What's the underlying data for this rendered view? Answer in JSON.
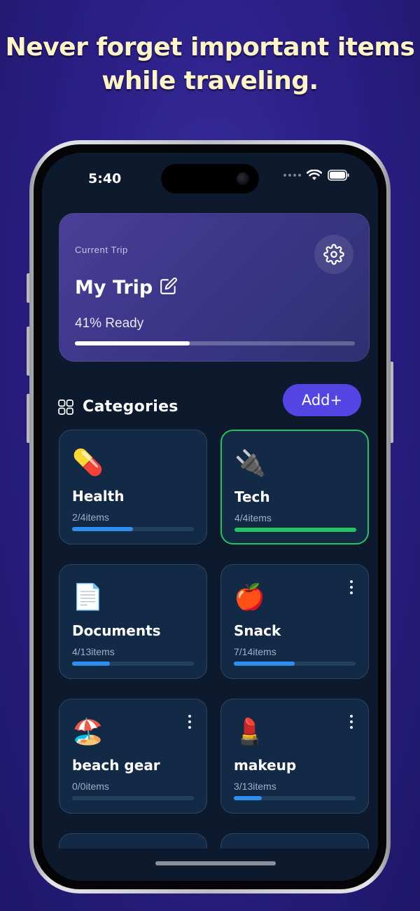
{
  "headline": {
    "line1": "Never forget important items",
    "line2": "while traveling."
  },
  "status_bar": {
    "time": "5:40"
  },
  "trip": {
    "label": "Current Trip",
    "title": "My Trip",
    "ready_text": "41% Ready",
    "ready_percent": 41
  },
  "categories": {
    "title": "Categories",
    "add_label": "Add+",
    "items": [
      {
        "emoji": "💊",
        "name": "Health",
        "count": "2/4items",
        "progress": 0.5,
        "menu": false,
        "active": false
      },
      {
        "emoji": "🔌",
        "name": "Tech",
        "count": "4/4items",
        "progress": 1.0,
        "menu": false,
        "active": true
      },
      {
        "emoji": "📄",
        "name": "Documents",
        "count": "4/13items",
        "progress": 0.31,
        "menu": false,
        "active": false
      },
      {
        "emoji": "🍎",
        "name": "Snack",
        "count": "7/14items",
        "progress": 0.5,
        "menu": true,
        "active": false
      },
      {
        "emoji": "🏖️",
        "name": "beach gear",
        "count": "0/0items",
        "progress": 0.0,
        "menu": true,
        "active": false
      },
      {
        "emoji": "💄",
        "name": "makeup",
        "count": "3/13items",
        "progress": 0.23,
        "menu": true,
        "active": false
      },
      {
        "emoji": "👟",
        "name": "",
        "count": "",
        "progress": 0.0,
        "menu": true,
        "active": false
      },
      {
        "emoji": "👕",
        "name": "",
        "count": "",
        "progress": 0.0,
        "menu": true,
        "active": false
      }
    ]
  },
  "colors": {
    "accent": "#5444e4",
    "progress_blue": "#2f8ef0",
    "progress_green": "#22c55e",
    "card_bg": "#132a47"
  }
}
